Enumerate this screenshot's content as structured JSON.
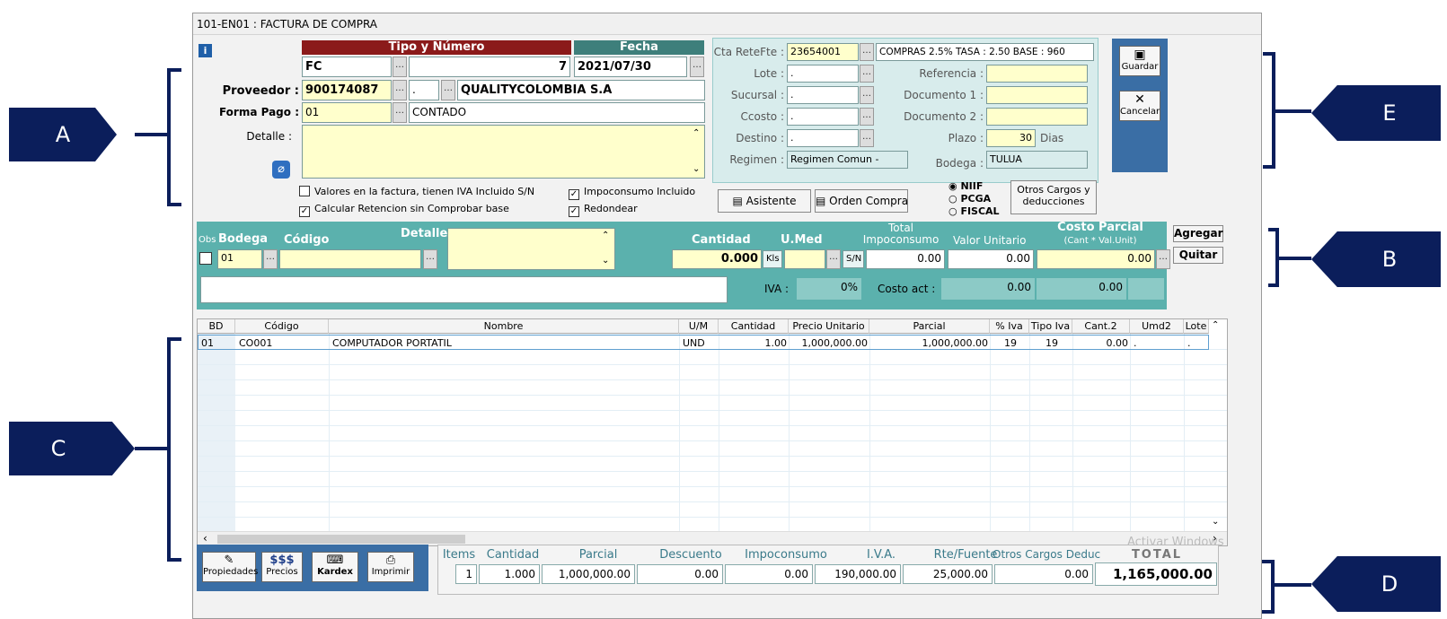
{
  "window_title": "101-EN01 : FACTURA DE COMPRA",
  "header": {
    "info_icon": "i",
    "tipo_numero_label": "Tipo y Número",
    "fecha_label": "Fecha",
    "tipo_value": "FC",
    "numero_value": "7",
    "fecha_value": "2021/07/30",
    "proveedor_label": "Proveedor :",
    "proveedor_code": "900174087",
    "proveedor_sub": ".",
    "proveedor_name": "QUALITYCOLOMBIA S.A",
    "forma_pago_label": "Forma Pago :",
    "forma_pago_code": "01",
    "forma_pago_name": "CONTADO",
    "detalle_label": "Detalle :",
    "chk_iva_incluido": "Valores en la factura, tienen  IVA Incluido S/N",
    "chk_calcular_retencion": "Calcular Retencion sin Comprobar base",
    "chk_impoconsumo": "Impoconsumo Incluido",
    "chk_redondear": "Redondear",
    "checkmark": "✓"
  },
  "right_panel": {
    "cta_retefte_label": "Cta ReteFte :",
    "cta_retefte_value": "23654001",
    "cta_retefte_desc": "COMPRAS 2.5%   TASA : 2.50   BASE : 960",
    "lote_label": "Lote :",
    "lote_value": ".",
    "referencia_label": "Referencia :",
    "sucursal_label": "Sucursal :",
    "sucursal_value": ".",
    "documento1_label": "Documento 1 :",
    "ccosto_label": "Ccosto :",
    "ccosto_value": ".",
    "documento2_label": "Documento 2 :",
    "destino_label": "Destino :",
    "destino_value": ".",
    "plazo_label": "Plazo :",
    "plazo_value": "30",
    "plazo_unit": "Dias",
    "regimen_label": "Regimen :",
    "regimen_value": "Regimen Comun -",
    "bodega_label": "Bodega :",
    "bodega_value": "TULUA",
    "asistente_label": "Asistente",
    "orden_compra_label": "Orden Compra",
    "radio_niif": "NIIF",
    "radio_pcga": "PCGA",
    "radio_fiscal": "FISCAL",
    "otros_cargos_line1": "Otros Cargos y",
    "otros_cargos_line2": "deducciones"
  },
  "actions": {
    "guardar_label": "Guardar",
    "cancelar_label": "Cancelar"
  },
  "item_entry": {
    "obs_label": "Obs",
    "bodega_label": "Bodega",
    "codigo_label": "Código",
    "detalle_label": "Detalle:",
    "cantidad_label": "Cantidad",
    "umed_label": "U.Med",
    "total_impo_line1": "Total",
    "total_impo_line2": "Impoconsumo",
    "valor_unitario_label": "Valor Unitario",
    "costo_parcial_label": "Costo Parcial",
    "costo_parcial_sub": "(Cant * Val.Unit)",
    "bodega_value": "01",
    "cantidad_value": "0.000",
    "kls_label": "Kls",
    "sn_label": "S/N",
    "total_impo_value": "0.00",
    "valor_unitario_value": "0.00",
    "costo_parcial_value": "0.00",
    "iva_label": "IVA :",
    "iva_value": "0%",
    "costo_act_label": "Costo act :",
    "costo_act_value1": "0.00",
    "costo_act_value2": "0.00",
    "agregar_label": "Agregar",
    "quitar_label": "Quitar"
  },
  "grid": {
    "columns": [
      "BD",
      "Código",
      "Nombre",
      "U/M",
      "Cantidad",
      "Precio Unitario",
      "Parcial",
      "% Iva",
      "Tipo Iva",
      "Cant.2",
      "Umd2",
      "Lote"
    ],
    "rows": [
      [
        "01",
        "CO001",
        "COMPUTADOR PORTATIL",
        "UND",
        "1.00",
        "1,000,000.00",
        "1,000,000.00",
        "19",
        "19",
        "0.00",
        ".",
        "."
      ]
    ]
  },
  "footer": {
    "propiedades_label": "Propiedades",
    "precios_icon": "$$$",
    "precios_label": "Precios",
    "kardex_label": "Kardex",
    "imprimir_label": "Imprimir",
    "summary_labels": [
      "Items",
      "Cantidad",
      "Parcial",
      "Descuento",
      "Impoconsumo",
      "I.V.A.",
      "Rte/Fuente",
      "Otros Cargos Deduc",
      "TOTAL"
    ],
    "summary_values": [
      "1",
      "1.000",
      "1,000,000.00",
      "0.00",
      "0.00",
      "190,000.00",
      "25,000.00",
      "0.00",
      "1,165,000.00"
    ],
    "watermark": "Activar Windows"
  },
  "callouts": [
    "A",
    "B",
    "C",
    "D",
    "E"
  ],
  "colors": {
    "teal": "#5bb1ad",
    "maroon": "#8b1a1a",
    "navy": "#0b1e5b",
    "yellow_field": "#ffffcc"
  }
}
